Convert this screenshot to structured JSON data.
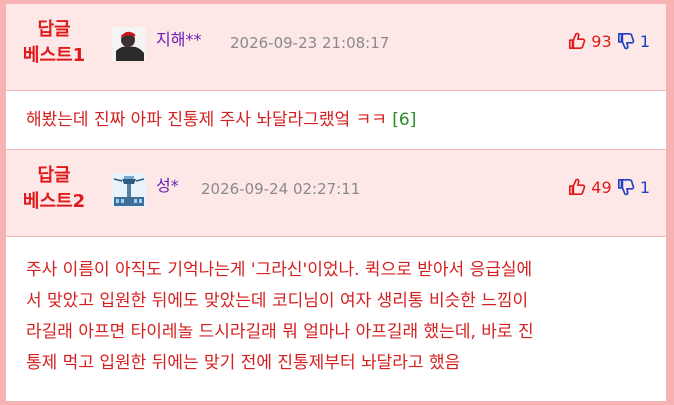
{
  "comments": [
    {
      "rank_line1": "답글",
      "rank_line2": "베스트1",
      "nickname": "지해**",
      "timestamp": "2026-09-23 21:08:17",
      "upvotes": "93",
      "downvotes": "1",
      "text": "해봤는데 진짜 아파 진통제 주사 놔달라그랬엌 ㅋㅋ",
      "reply_count": "[6]"
    },
    {
      "rank_line1": "답글",
      "rank_line2": "베스트2",
      "nickname": "성*",
      "timestamp": "2026-09-24 02:27:11",
      "upvotes": "49",
      "downvotes": "1",
      "text_lines": [
        "주사 이름이 아직도 기억나는게 '그라신'이었나. 퀵으로 받아서 응급실에",
        "서 맞았고 입원한 뒤에도 맞았는데 코디님이 여자 생리통 비슷한 느낌이",
        "라길래 아프면 타이레놀 드시라길래 뭐 얼마나 아프길래 했는데, 바로 진",
        "통제 먹고 입원한 뒤에는 맞기 전에 진통제부터 놔달라고 했음"
      ]
    }
  ],
  "colors": {
    "outer_border": "#f7b3b3",
    "header_bg": "#fde7e7",
    "rank_red": "#e01a1a",
    "nick_purple": "#6a1fb5",
    "downvote_blue": "#1c3fc4",
    "reply_green": "#2a8a2a"
  },
  "icons": {
    "upvote": "thumbs-up-icon",
    "downvote": "thumbs-down-icon"
  }
}
